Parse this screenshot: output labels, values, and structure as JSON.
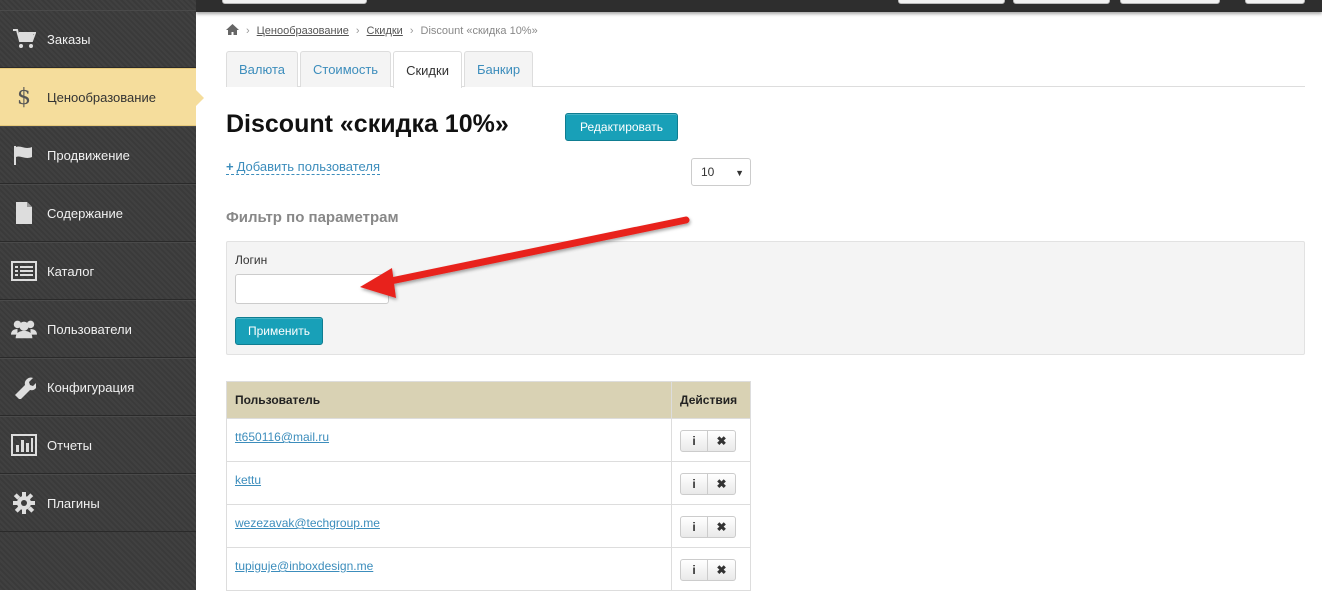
{
  "sidebar": {
    "items": [
      {
        "label": "Заказы",
        "icon": "cart-icon"
      },
      {
        "label": "Ценообразование",
        "icon": "dollar-icon",
        "active": true
      },
      {
        "label": "Продвижение",
        "icon": "flag-icon"
      },
      {
        "label": "Содержание",
        "icon": "document-icon"
      },
      {
        "label": "Каталог",
        "icon": "list-icon"
      },
      {
        "label": "Пользователи",
        "icon": "users-icon"
      },
      {
        "label": "Конфигурация",
        "icon": "wrench-icon"
      },
      {
        "label": "Отчеты",
        "icon": "chart-icon"
      },
      {
        "label": "Плагины",
        "icon": "gear-icon"
      }
    ]
  },
  "breadcrumb": {
    "pricing": "Ценообразование",
    "discounts": "Скидки",
    "current": "Discount «скидка 10%»"
  },
  "tabs": [
    "Валюта",
    "Стоимость",
    "Скидки",
    "Банкир"
  ],
  "active_tab": "Скидки",
  "page": {
    "title": "Discount «скидка 10%»",
    "edit_label": "Редактировать",
    "add_user_label": "Добавить пользователя",
    "per_page": "10"
  },
  "filter": {
    "title": "Фильтр по параметрам",
    "login_label": "Логин",
    "login_value": "",
    "apply_label": "Применить"
  },
  "table": {
    "headers": {
      "user": "Пользователь",
      "actions": "Действия"
    },
    "rows": [
      {
        "user": "tt650116@mail.ru"
      },
      {
        "user": "kettu"
      },
      {
        "user": "wezezavak@techgroup.me"
      },
      {
        "user": "tupiguje@inboxdesign.me"
      }
    ],
    "info_symbol": "i",
    "delete_symbol": "✖"
  },
  "colors": {
    "sidebar_bg": "#3c3c3c",
    "sidebar_active": "#f5dd9c",
    "accent_teal": "#18a0b8",
    "link": "#3c8dbc",
    "table_header": "#d9d2b4",
    "annotation_arrow": "#e8231e"
  }
}
